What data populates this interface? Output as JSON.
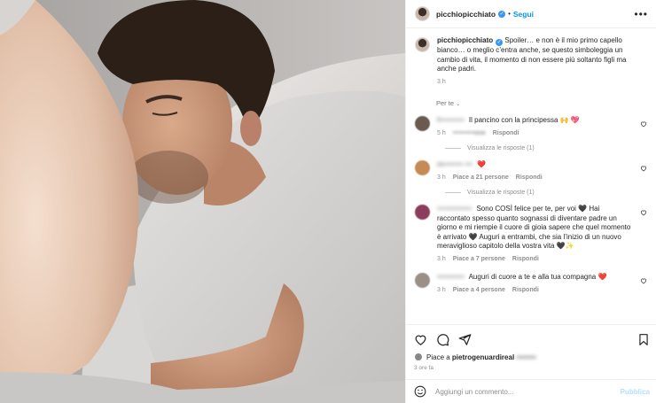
{
  "header": {
    "username": "picchiopicchiato",
    "separator": "•",
    "follow_label": "Segui",
    "more_label": "•••"
  },
  "caption": {
    "username": "picchiopicchiato",
    "text": "Spoiler… e non è il mio primo capello bianco… o meglio c’entra anche, se questo simboleggia un cambio di vita, il momento di non essere più soltanto figli ma anche padri.",
    "time": "3 h"
  },
  "sort_label": "Per te",
  "comments": [
    {
      "name": "f••••••••••",
      "text": "Il pancino con la principessa 🙌 💖",
      "time": "5 h",
      "likes": "••••••••••one",
      "reply": "Rispondi",
      "replies": "Visualizza le risposte (1)",
      "avatar_color": "#6b5a50"
    },
    {
      "name": "m•••••••• •••",
      "text": "❤️",
      "time": "3 h",
      "likes": "Piace a 21 persone",
      "reply": "Rispondi",
      "replies": "Visualizza le risposte (1)",
      "avatar_color": "#c48b55"
    },
    {
      "name": "••••••••••••••",
      "text": "Sono COSÌ felice per te, per voi 🖤 Hai raccontato spesso quanto sognassi di diventare padre un giorno e mi riempie il cuore di gioia sapere che quel momento è arrivato 🖤 Auguri a entrambi, che sia l’inizio di un nuovo meraviglioso capitolo della vostra vita 🖤✨",
      "time": "3 h",
      "likes": "Piace a 7 persone",
      "reply": "Rispondi",
      "replies": "",
      "avatar_color": "#8a3d5c"
    },
    {
      "name": "•••••••••••",
      "text": "Auguri di cuore a te e alla tua compagna ❤️",
      "time": "3 h",
      "likes": "Piace a 4 persone",
      "reply": "Rispondi",
      "replies": "",
      "avatar_color": "#9a9088"
    }
  ],
  "likes": {
    "prefix": "Piace a",
    "username": "pietrogenuardireal",
    "others": "••••••••"
  },
  "posted_ago": "3 ore fa",
  "add_comment": {
    "placeholder": "Aggiungi un commento...",
    "publish_label": "Pubblica"
  }
}
